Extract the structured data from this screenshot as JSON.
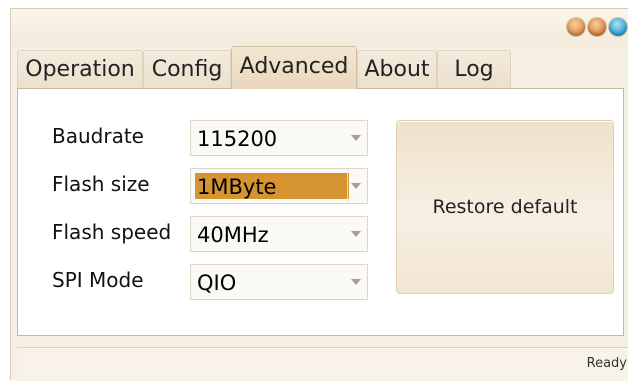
{
  "window": {
    "controls": [
      "minimize-icon",
      "maximize-icon",
      "close-icon"
    ]
  },
  "tabs": [
    {
      "label": "Operation",
      "active": false
    },
    {
      "label": "Config",
      "active": false
    },
    {
      "label": "Advanced",
      "active": true
    },
    {
      "label": "About",
      "active": false
    },
    {
      "label": "Log",
      "active": false
    }
  ],
  "advanced": {
    "fields": [
      {
        "label": "Baudrate",
        "value": "115200",
        "highlighted": false
      },
      {
        "label": "Flash size",
        "value": "1MByte",
        "highlighted": true
      },
      {
        "label": "Flash speed",
        "value": "40MHz",
        "highlighted": false
      },
      {
        "label": "SPI Mode",
        "value": "QIO",
        "highlighted": false
      }
    ],
    "restore_label": "Restore default"
  },
  "status": {
    "text": "Ready"
  },
  "colors": {
    "selection": "#d69431",
    "window_bg": "#f6efe3",
    "close_button": "#2a9ed2"
  }
}
